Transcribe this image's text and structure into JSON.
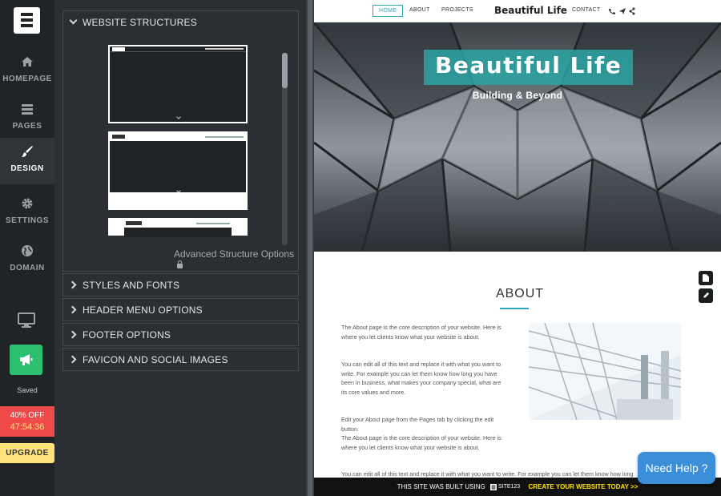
{
  "nav": {
    "items": [
      {
        "label": "HOMEPAGE",
        "icon": "home-icon"
      },
      {
        "label": "PAGES",
        "icon": "pages-icon"
      },
      {
        "label": "DESIGN",
        "icon": "brush-icon"
      },
      {
        "label": "SETTINGS",
        "icon": "gear-icon"
      },
      {
        "label": "DOMAIN",
        "icon": "globe-icon"
      }
    ],
    "active": "DESIGN",
    "saved_label": "Saved",
    "promo_discount": "40% OFF",
    "promo_timer": "47:54:36",
    "upgrade_label": "UPGRADE"
  },
  "panel": {
    "structures_title": "WEBSITE STRUCTURES",
    "advanced_label": "Advanced Structure Options",
    "sections": [
      {
        "label": "STYLES AND FONTS"
      },
      {
        "label": "HEADER MENU OPTIONS"
      },
      {
        "label": "FOOTER OPTIONS"
      },
      {
        "label": "FAVICON AND SOCIAL IMAGES"
      }
    ]
  },
  "preview": {
    "menu": {
      "home": "HOME",
      "about": "ABOUT",
      "projects": "PROJECTS",
      "contact": "CONTACT"
    },
    "brand": "Beautiful Life",
    "hero_title": "Beautiful Life",
    "hero_subtitle": "Building & Beyond",
    "about_heading": "ABOUT",
    "para1": "The About page is the core description of your website. Here is where you let clients know what your website is about.",
    "para2": "You can edit all of this text and replace it with what you want to write. For example you can let them know how long you have been in business, what makes your company special, what are its core values and more.",
    "para3": "Edit your About page from the Pages tab by clicking the edit button.",
    "para4": "The About page is the core description of your website. Here is where you let clients know what your website is about.",
    "para5": "You can edit all of this text and replace it with what you want to write. For example you can let them know how long",
    "footer_text": "THIS SITE WAS BUILT USING",
    "footer_brand": "SITE123",
    "footer_cta": "CREATE YOUR WEBSITE TODAY >>",
    "help_label": "Need Help ?"
  },
  "colors": {
    "accent": "#2aa8b8",
    "promo": "#ef4a4a",
    "upgrade": "#ffe27a",
    "help": "#3a8fd8",
    "cta": "#ffe200"
  }
}
